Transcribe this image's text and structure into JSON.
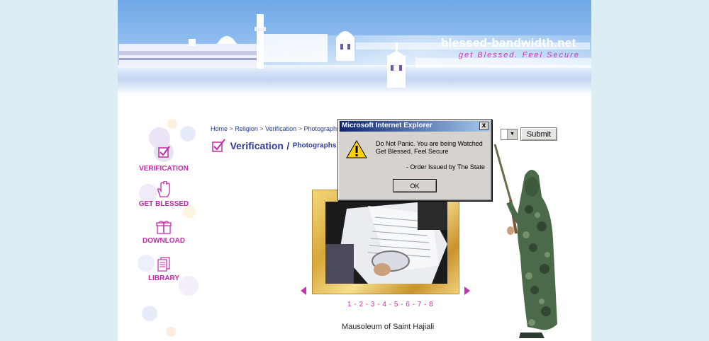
{
  "site": {
    "name": "blessed-bandwidth.net",
    "tagline": "get Blessed. Feel Secure"
  },
  "sidenav": {
    "items": [
      {
        "label": "VERIFICATION",
        "icon": "checkbox-icon"
      },
      {
        "label": "GET BLESSED",
        "icon": "hand-icon"
      },
      {
        "label": "DOWNLOAD",
        "icon": "gift-icon"
      },
      {
        "label": "LIBRARY",
        "icon": "document-icon"
      }
    ]
  },
  "breadcrumb": {
    "items": [
      "Home",
      "Religion",
      "Verification",
      "Photographs"
    ],
    "separator": ">"
  },
  "heading": {
    "main": "Verification",
    "slash": "/",
    "sub": "Photographs"
  },
  "form": {
    "submit_label": "Submit",
    "select_arrow": "▼"
  },
  "gallery": {
    "pager": [
      "1",
      "2",
      "3",
      "4",
      "5",
      "6",
      "7",
      "8"
    ],
    "pager_separator": " - ",
    "caption": "Mausoleum of Saint Hajiali"
  },
  "dialog": {
    "title": "Microsoft Internet Explorer",
    "close_label": "x",
    "line1": "Do Not Panic. You are being Watched",
    "line2": "Get Blessed. Feel Secure",
    "line3": "- Order Issued by The State",
    "ok_label": "OK"
  },
  "colors": {
    "accent": "#c52aa8",
    "heading": "#2f3d9a",
    "dialog_title_start": "#0a246a"
  }
}
